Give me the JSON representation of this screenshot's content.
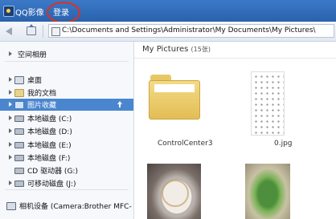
{
  "titlebar": {
    "app_title": "QQ影像",
    "login_label": "登录"
  },
  "toolbar": {
    "address": "C:\\Documents and Settings\\Administrator\\My Documents\\My Pictures\\"
  },
  "sidebar": {
    "top_item": "空间相册",
    "items": [
      {
        "label": "桌面",
        "icon": "desktop-icon"
      },
      {
        "label": "我的文档",
        "icon": "folder-icon"
      },
      {
        "label": "图片收藏",
        "icon": "picture-folder-icon",
        "selected": true
      },
      {
        "label": "本地磁盘 (C:)",
        "icon": "drive-icon"
      },
      {
        "label": "本地磁盘 (D:)",
        "icon": "drive-icon"
      },
      {
        "label": "本地磁盘 (E:)",
        "icon": "drive-icon"
      },
      {
        "label": "本地磁盘 (F:)",
        "icon": "drive-icon"
      },
      {
        "label": "CD 驱动器 (G:)",
        "icon": "cd-drive-icon"
      },
      {
        "label": "可移动磁盘 (J:)",
        "icon": "removable-drive-icon"
      }
    ],
    "bottom_item": "相机设备 (Camera:Brother MFC-"
  },
  "main": {
    "folder_title": "My Pictures",
    "folder_count": "(15张)",
    "thumbnails": [
      {
        "caption": "ControlCenter3"
      },
      {
        "caption": "0.jpg"
      }
    ]
  },
  "colors": {
    "titlebar": "#2f6dbd",
    "selection": "#4a86cf",
    "highlight_ring": "#e0301e"
  }
}
